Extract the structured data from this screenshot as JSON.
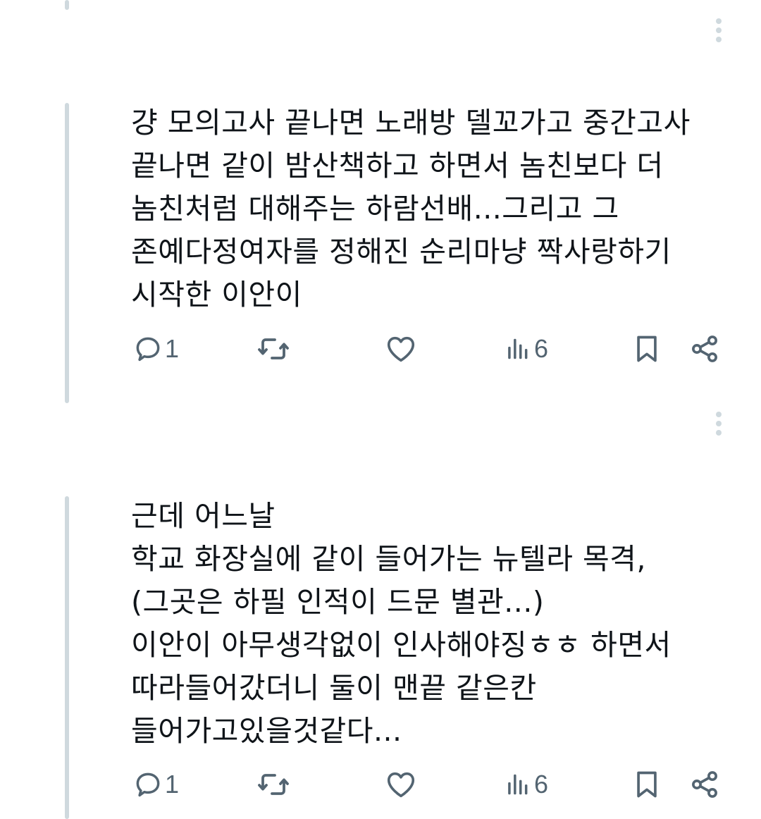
{
  "posts": [
    {
      "text": "걍 모의고사 끝나면 노래방 델꼬가고 중간고사\n끝나면 같이 밤산책하고 하면서 놈친보다 더\n놈친처럼 대해주는 하람선배...그리고 그\n존예다정여자를 정해진 순리마냥 짝사랑하기\n시작한 이안이",
      "reply_count": "1",
      "view_count": "6",
      "icons": {
        "more": "more-vertical-icon",
        "reply": "reply-icon",
        "repost": "repost-icon",
        "like": "heart-icon",
        "views": "views-icon",
        "bookmark": "bookmark-icon",
        "share": "share-icon"
      }
    },
    {
      "text": "근데 어느날\n학교 화장실에 같이 들어가는 뉴텔라 목격,\n(그곳은 하필 인적이 드문 별관...)\n이안이 아무생각없이 인사해야징ㅎㅎ 하면서\n따라들어갔더니 둘이 맨끝 같은칸\n들어가고있을것같다...",
      "reply_count": "1",
      "view_count": "6",
      "icons": {
        "more": "more-vertical-icon",
        "reply": "reply-icon",
        "repost": "repost-icon",
        "like": "heart-icon",
        "views": "views-icon",
        "bookmark": "bookmark-icon",
        "share": "share-icon"
      }
    }
  ],
  "colors": {
    "text": "#0f1419",
    "icon": "#536471",
    "thread_line": "#cfd9de"
  }
}
